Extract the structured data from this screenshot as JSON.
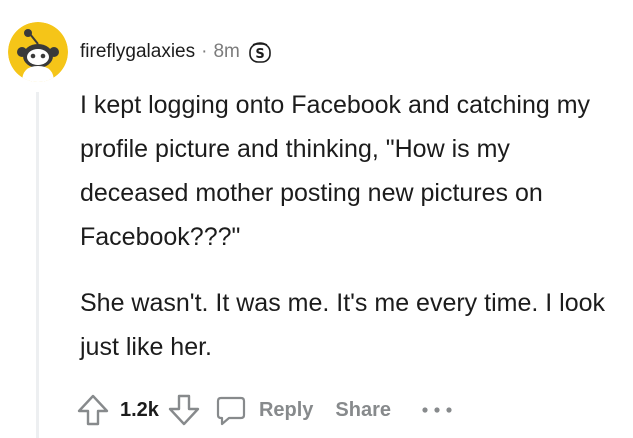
{
  "comment": {
    "username": "fireflygalaxies",
    "separator": "·",
    "time_ago": "8m",
    "badge_letter": "S",
    "paragraphs": [
      "I kept logging onto Facebook and catching my profile picture and thinking, \"How is my deceased mother posting new pictures on Facebook???\"",
      "She wasn't. It was me. It's me every time. I look just like her."
    ],
    "score": "1.2k",
    "reply_label": "Reply",
    "share_label": "Share"
  },
  "icons": {
    "avatar": "snoo-avatar-icon",
    "edited": "edited-icon",
    "upvote": "upvote-arrow-icon",
    "downvote": "downvote-arrow-icon",
    "reply": "comment-bubble-icon",
    "more": "more-options-icon"
  },
  "colors": {
    "avatar_bg": "#f5c518",
    "text_primary": "#1c1c1c",
    "text_muted": "#878a8c",
    "meta": "#7c7c7c",
    "thread_line": "#edeff1"
  }
}
